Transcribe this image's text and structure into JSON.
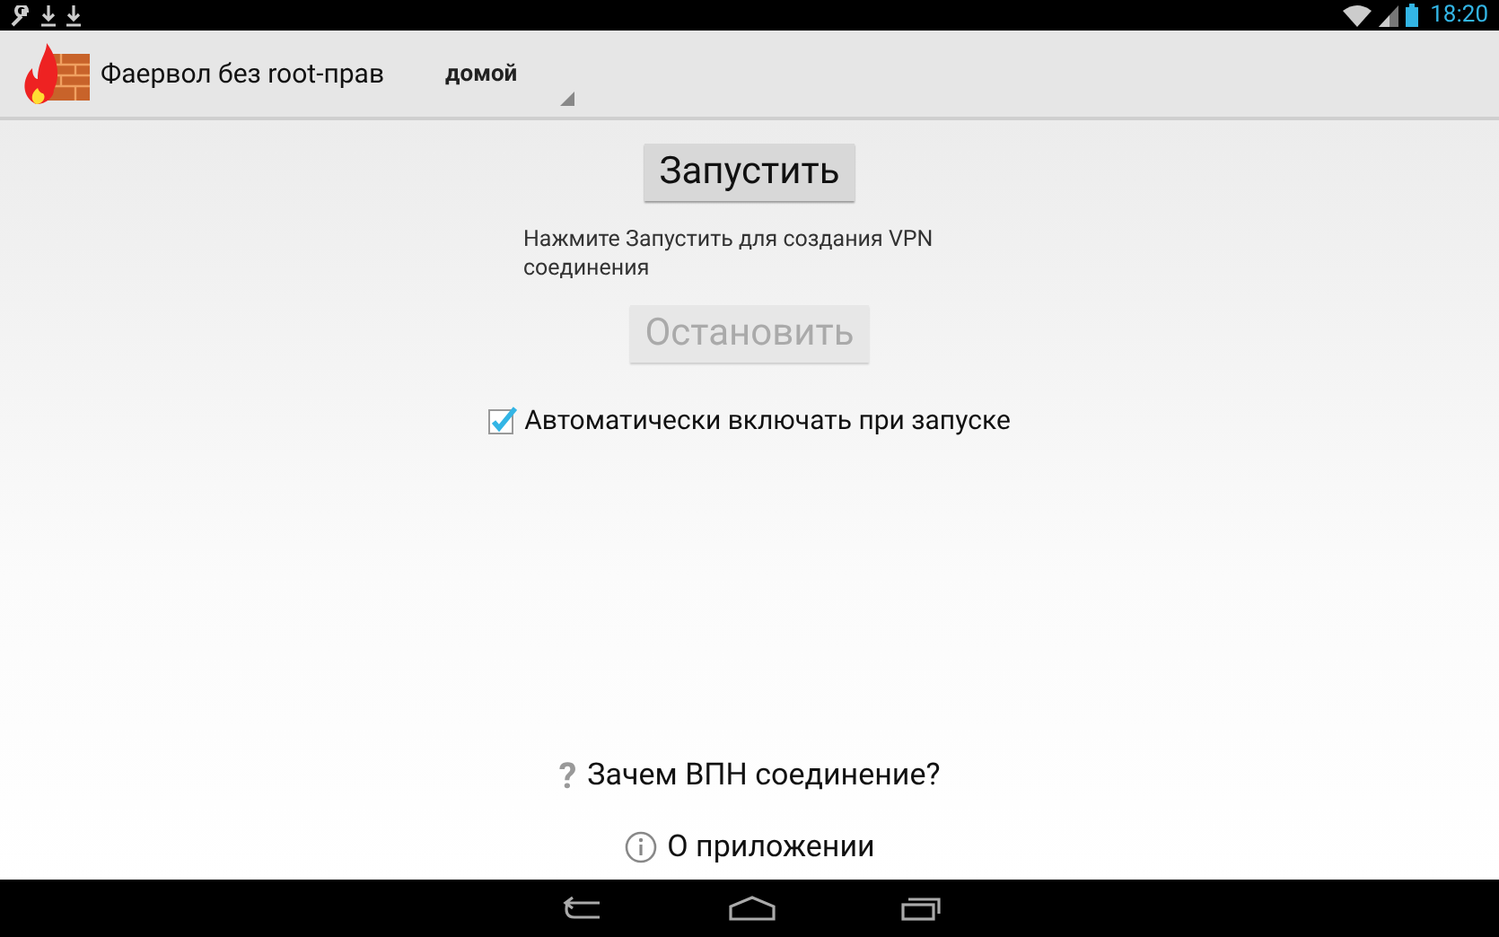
{
  "status_bar": {
    "time": "18:20"
  },
  "action_bar": {
    "title": "Фаервол без root-прав",
    "profile": "домой"
  },
  "start_button": {
    "label": "Запустить",
    "disabled": false
  },
  "hint": "Нажмите Запустить для создания VPN соединения",
  "stop_button": {
    "label": "Остановить",
    "disabled": true
  },
  "autostart": {
    "label": "Автоматически включать при запуске",
    "checked": true
  },
  "links": [
    {
      "kind": "help",
      "icon": "?",
      "label": "Зачем ВПН соединение?"
    },
    {
      "kind": "info",
      "label": "О приложении"
    }
  ]
}
